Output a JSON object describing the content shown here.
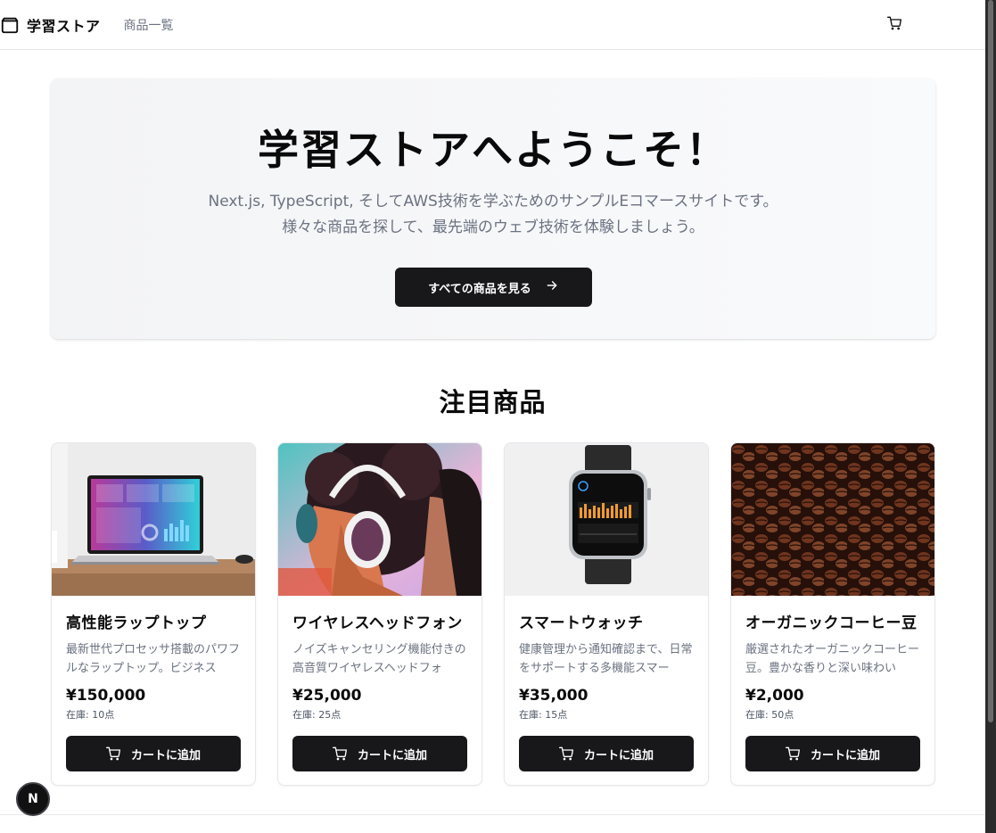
{
  "header": {
    "logo_text": "学習ストア",
    "nav_products": "商品一覧"
  },
  "hero": {
    "title": "学習ストアへようこそ！",
    "subtitle_line1": "Next.js, TypeScript, そしてAWS技術を学ぶためのサンプルEコマースサイトです。",
    "subtitle_line2": "様々な商品を探して、最先端のウェブ技術を体験しましょう。",
    "cta_label": "すべての商品を見る"
  },
  "featured": {
    "title": "注目商品",
    "add_to_cart_label": "カートに追加",
    "products": [
      {
        "name": "高性能ラップトップ",
        "description": "最新世代プロセッサ搭載のパワフルなラップトップ。ビジネス",
        "price": "¥150,000",
        "stock": "在庫: 10点"
      },
      {
        "name": "ワイヤレスヘッドフォン",
        "description": "ノイズキャンセリング機能付きの高音質ワイヤレスヘッドフォ",
        "price": "¥25,000",
        "stock": "在庫: 25点"
      },
      {
        "name": "スマートウォッチ",
        "description": "健康管理から通知確認まで、日常をサポートする多機能スマー",
        "price": "¥35,000",
        "stock": "在庫: 15点"
      },
      {
        "name": "オーガニックコーヒー豆",
        "description": "厳選されたオーガニックコーヒー豆。豊かな香りと深い味わい",
        "price": "¥2,000",
        "stock": "在庫: 50点"
      }
    ]
  },
  "dev_badge": {
    "letter": "N"
  },
  "colors": {
    "primary_button": "#18181b",
    "muted_text": "#6b7280",
    "border": "#e5e7eb"
  },
  "icons": {
    "logo": "shopping-bag-icon",
    "cart": "cart-icon",
    "arrow": "arrow-right-icon"
  }
}
